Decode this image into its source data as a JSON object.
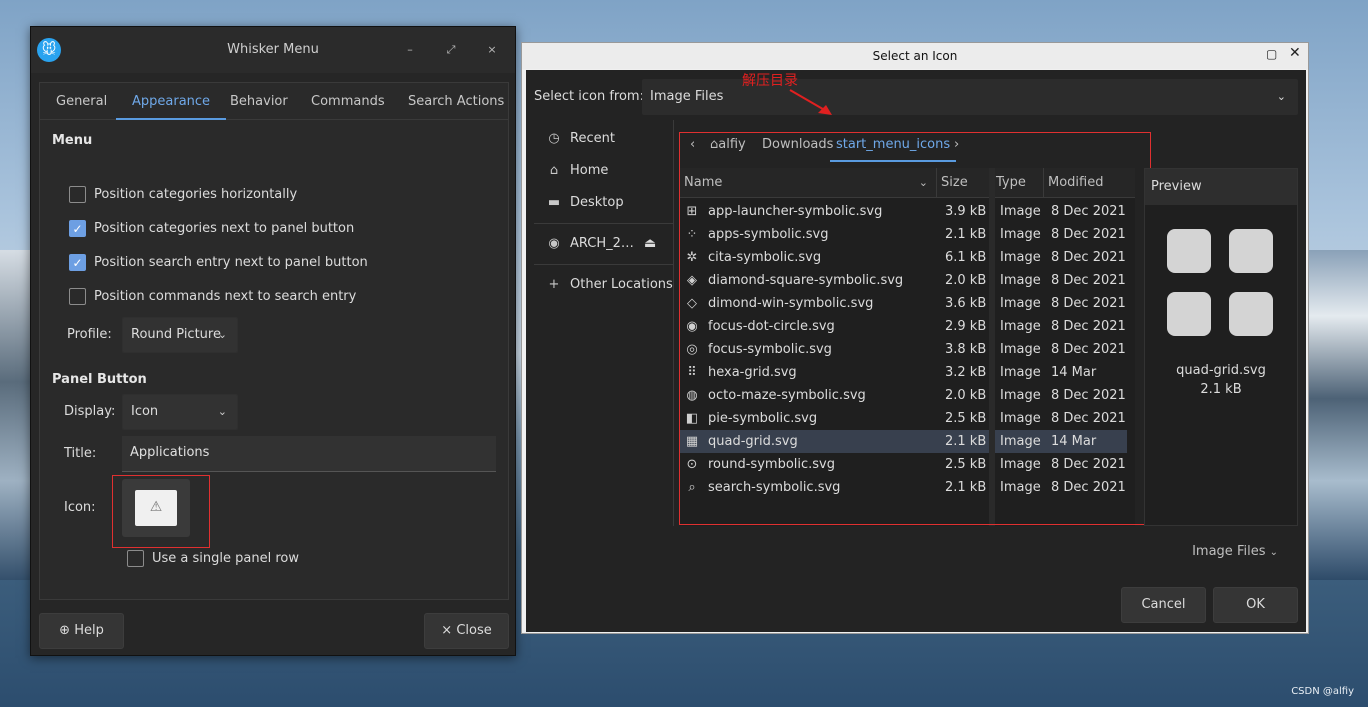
{
  "whisker": {
    "title": "Whisker Menu",
    "tabs": [
      {
        "label": "General"
      },
      {
        "label": "Appearance"
      },
      {
        "label": "Behavior"
      },
      {
        "label": "Commands"
      },
      {
        "label": "Search Actions"
      }
    ],
    "menu_section": "Menu",
    "options": [
      {
        "label": "Position categories horizontally",
        "checked": false
      },
      {
        "label": "Position categories next to panel button",
        "checked": true
      },
      {
        "label": "Position search entry next to panel button",
        "checked": true
      },
      {
        "label": "Position commands next to search entry",
        "checked": false
      }
    ],
    "profile_label": "Profile:",
    "profile_value": "Round Picture",
    "panel_section": "Panel Button",
    "display_label": "Display:",
    "display_value": "Icon",
    "title_label": "Title:",
    "title_value": "Applications",
    "icon_label": "Icon:",
    "single_row_label": "Use a single panel row",
    "help_label": "Help",
    "close_label": "Close"
  },
  "dialog": {
    "title": "Select an Icon",
    "source_label": "Select icon from:",
    "source_value": "Image Files",
    "annotation": "解压目录",
    "places": [
      {
        "label": "Recent",
        "icon": "clock-icon"
      },
      {
        "label": "Home",
        "icon": "home-icon"
      },
      {
        "label": "Desktop",
        "icon": "folder-icon"
      },
      {
        "label": "ARCH_2…",
        "icon": "disc-icon"
      },
      {
        "label": "Other Locations",
        "icon": "plus-icon"
      }
    ],
    "path": [
      "alfiy",
      "Downloads",
      "start_menu_icons"
    ],
    "columns": [
      "Name",
      "Size",
      "Type",
      "Modified"
    ],
    "files": [
      {
        "name": "app-launcher-symbolic.svg",
        "size": "3.9 kB",
        "type": "Image",
        "modified": "8 Dec 2021",
        "icon": "grid-circle-icon"
      },
      {
        "name": "apps-symbolic.svg",
        "size": "2.1 kB",
        "type": "Image",
        "modified": "8 Dec 2021",
        "icon": "apps-icon"
      },
      {
        "name": "cita-symbolic.svg",
        "size": "6.1 kB",
        "type": "Image",
        "modified": "8 Dec 2021",
        "icon": "cita-icon"
      },
      {
        "name": "diamond-square-symbolic.svg",
        "size": "2.0 kB",
        "type": "Image",
        "modified": "8 Dec 2021",
        "icon": "diamond-square-icon"
      },
      {
        "name": "dimond-win-symbolic.svg",
        "size": "3.6 kB",
        "type": "Image",
        "modified": "8 Dec 2021",
        "icon": "diamond-win-icon"
      },
      {
        "name": "focus-dot-circle.svg",
        "size": "2.9 kB",
        "type": "Image",
        "modified": "8 Dec 2021",
        "icon": "dot-circle-icon"
      },
      {
        "name": "focus-symbolic.svg",
        "size": "3.8 kB",
        "type": "Image",
        "modified": "8 Dec 2021",
        "icon": "focus-icon"
      },
      {
        "name": "hexa-grid.svg",
        "size": "3.2 kB",
        "type": "Image",
        "modified": "14 Mar",
        "icon": "hexa-grid-icon"
      },
      {
        "name": "octo-maze-symbolic.svg",
        "size": "2.0 kB",
        "type": "Image",
        "modified": "8 Dec 2021",
        "icon": "maze-icon"
      },
      {
        "name": "pie-symbolic.svg",
        "size": "2.5 kB",
        "type": "Image",
        "modified": "8 Dec 2021",
        "icon": "pie-icon"
      },
      {
        "name": "quad-grid.svg",
        "size": "2.1 kB",
        "type": "Image",
        "modified": "14 Mar",
        "icon": "quad-grid-icon",
        "selected": true
      },
      {
        "name": "round-symbolic.svg",
        "size": "2.5 kB",
        "type": "Image",
        "modified": "8 Dec 2021",
        "icon": "round-icon"
      },
      {
        "name": "search-symbolic.svg",
        "size": "2.1 kB",
        "type": "Image",
        "modified": "8 Dec 2021",
        "icon": "search-icon"
      }
    ],
    "preview_title": "Preview",
    "preview_name": "quad-grid.svg",
    "preview_size": "2.1 kB",
    "filter_label": "Image Files",
    "cancel_label": "Cancel",
    "ok_label": "OK"
  },
  "watermark": "CSDN @alfiy",
  "colors": {
    "accent": "#6fa8e8",
    "annotation": "#e02020",
    "selected_row": "#38404e"
  }
}
